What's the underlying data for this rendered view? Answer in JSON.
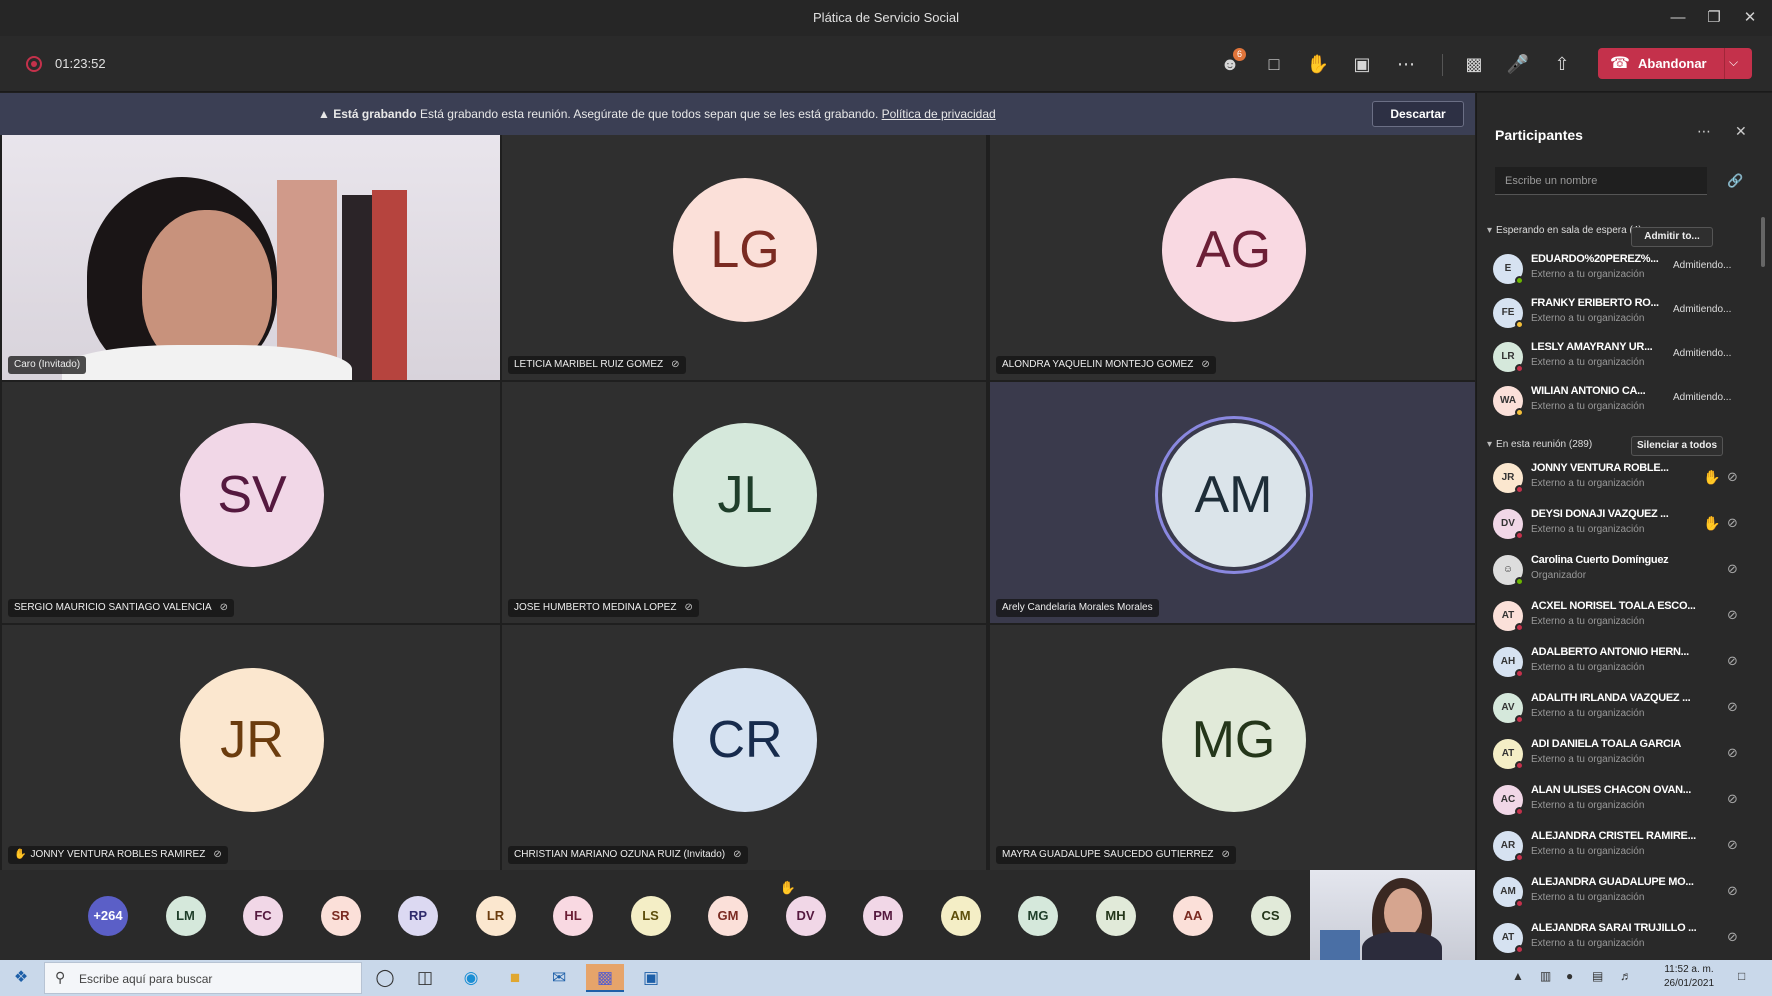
{
  "window": {
    "title": "Plática de Servicio Social"
  },
  "toolbar": {
    "timer": "01:23:52",
    "participants_badge": "6",
    "leave_label": "Abandonar"
  },
  "banner": {
    "bold": "Está grabando",
    "text": "Está grabando esta reunión. Asegúrate de que todos sepan que se les está grabando.",
    "link": "Política de privacidad",
    "dismiss": "Descartar"
  },
  "tiles": [
    {
      "name": "Caro (Invitado)",
      "video": true
    },
    {
      "initials": "LG",
      "name": "LETICIA MARIBEL RUIZ GOMEZ",
      "bg": "#fbe0d9",
      "fg": "#7a2b22"
    },
    {
      "initials": "AG",
      "name": "ALONDRA YAQUELIN MONTEJO GOMEZ",
      "bg": "#f9d9e2",
      "fg": "#6c1f36"
    },
    {
      "initials": "SV",
      "name": "SERGIO MAURICIO SANTIAGO VALENCIA",
      "bg": "#f1d7e7",
      "fg": "#55193f"
    },
    {
      "initials": "JL",
      "name": "JOSE HUMBERTO MEDINA LOPEZ",
      "bg": "#d5e8db",
      "fg": "#1f3e2a"
    },
    {
      "initials": "AM",
      "name": "Arely Candelaria Morales Morales",
      "bg": "#dbe4ea",
      "fg": "#1e2d38",
      "active": true
    },
    {
      "initials": "JR",
      "name": "JONNY VENTURA ROBLES RAMIREZ",
      "bg": "#fbe7cf",
      "fg": "#6b3c0e",
      "hand": true
    },
    {
      "initials": "CR",
      "name": "CHRISTIAN MARIANO OZUNA RUIZ (Invitado)",
      "bg": "#d6e2f1",
      "fg": "#172b4d"
    },
    {
      "initials": "MG",
      "name": "MAYRA GUADALUPE SAUCEDO GUTIERREZ",
      "bg": "#e1ead9",
      "fg": "#24361a"
    }
  ],
  "strip": [
    {
      "t": "+264",
      "bg": "#5b5fc7",
      "fg": "#ffffff"
    },
    {
      "t": "LM",
      "bg": "#d5e8db",
      "fg": "#1f3e2a"
    },
    {
      "t": "FC",
      "bg": "#f1d7e7",
      "fg": "#55193f"
    },
    {
      "t": "SR",
      "bg": "#fbe0d9",
      "fg": "#7a2b22"
    },
    {
      "t": "RP",
      "bg": "#dcd9f2",
      "fg": "#2e2a6b"
    },
    {
      "t": "LR",
      "bg": "#fbe7cf",
      "fg": "#6b3c0e"
    },
    {
      "t": "HL",
      "bg": "#f9d9e2",
      "fg": "#6c1f36"
    },
    {
      "t": "LS",
      "bg": "#f4eec6",
      "fg": "#5e4f0c"
    },
    {
      "t": "GM",
      "bg": "#fbe0d9",
      "fg": "#7a2b22"
    },
    {
      "t": "DV",
      "bg": "#f1d7e7",
      "fg": "#55193f",
      "hand": true
    },
    {
      "t": "PM",
      "bg": "#f1d7e7",
      "fg": "#55193f"
    },
    {
      "t": "AM",
      "bg": "#f4eec6",
      "fg": "#5e4f0c"
    },
    {
      "t": "MG",
      "bg": "#d5e8db",
      "fg": "#1f3e2a"
    },
    {
      "t": "MH",
      "bg": "#e1ead9",
      "fg": "#24361a"
    },
    {
      "t": "AA",
      "bg": "#fbe0d9",
      "fg": "#7a2b22"
    },
    {
      "t": "CS",
      "bg": "#e1ead9",
      "fg": "#24361a"
    }
  ],
  "panel": {
    "title": "Participantes",
    "search_placeholder": "Escribe un nombre",
    "lobby_head": "Esperando en sala de espera (4)",
    "lobby_btn": "Admitir to...",
    "meeting_head": "En esta reunión (289)",
    "meeting_btn": "Silenciar a todos",
    "lobby": [
      {
        "i": "E",
        "name": "EDUARDO%20PEREZ%...",
        "sub": "Externo a tu organización",
        "action": "Admitiendo...",
        "bg": "#d6e2f1",
        "st": "#6bb700"
      },
      {
        "i": "FE",
        "name": "FRANKY ERIBERTO RO...",
        "sub": "Externo a tu organización",
        "action": "Admitiendo...",
        "bg": "#d6e2f1",
        "st": "#f5c03a"
      },
      {
        "i": "LR",
        "name": "LESLY AMAYRANY UR...",
        "sub": "Externo a tu organización",
        "action": "Admitiendo...",
        "bg": "#d5e8db",
        "st": "#c4314b"
      },
      {
        "i": "WA",
        "name": "WILIAN ANTONIO CA...",
        "sub": "Externo a tu organización",
        "action": "Admitiendo...",
        "bg": "#fbe0d9",
        "st": "#f5c03a"
      }
    ],
    "members": [
      {
        "i": "JR",
        "name": "JONNY VENTURA ROBLE...",
        "sub": "Externo a tu organización",
        "bg": "#fbe7cf",
        "st": "#c4314b",
        "hand": true
      },
      {
        "i": "DV",
        "name": "DEYSI DONAJI VAZQUEZ ...",
        "sub": "Externo a tu organización",
        "bg": "#f1d7e7",
        "st": "#c4314b",
        "hand": true
      },
      {
        "i": "CC",
        "name": "Carolina Cuerto Domínguez",
        "sub": "Organizador",
        "bg": "#e8e8e8",
        "st": "#6bb700",
        "photo": true
      },
      {
        "i": "AT",
        "name": "ACXEL NORISEL TOALA ESCO...",
        "sub": "Externo a tu organización",
        "bg": "#fbe0d9",
        "st": "#c4314b"
      },
      {
        "i": "AH",
        "name": "ADALBERTO ANTONIO HERN...",
        "sub": "Externo a tu organización",
        "bg": "#d6e2f1",
        "st": "#c4314b"
      },
      {
        "i": "AV",
        "name": "ADALITH IRLANDA VAZQUEZ ...",
        "sub": "Externo a tu organización",
        "bg": "#d5e8db",
        "st": "#c4314b"
      },
      {
        "i": "AT",
        "name": "ADI DANIELA TOALA GARCIA",
        "sub": "Externo a tu organización",
        "bg": "#f4eec6",
        "st": "#c4314b"
      },
      {
        "i": "AC",
        "name": "ALAN ULISES CHACON OVAN...",
        "sub": "Externo a tu organización",
        "bg": "#f1d7e7",
        "st": "#c4314b"
      },
      {
        "i": "AR",
        "name": "ALEJANDRA CRISTEL RAMIRE...",
        "sub": "Externo a tu organización",
        "bg": "#d6e2f1",
        "st": "#c4314b"
      },
      {
        "i": "AM",
        "name": "ALEJANDRA GUADALUPE MO...",
        "sub": "Externo a tu organización",
        "bg": "#d6e2f1",
        "st": "#c4314b"
      },
      {
        "i": "AT",
        "name": "ALEJANDRA SARAI TRUJILLO ...",
        "sub": "Externo a tu organización",
        "bg": "#d6e2f1",
        "st": "#c4314b"
      }
    ]
  },
  "taskbar": {
    "search_placeholder": "Escribe aquí para buscar",
    "time": "11:52 a. m.",
    "date": "26/01/2021"
  }
}
